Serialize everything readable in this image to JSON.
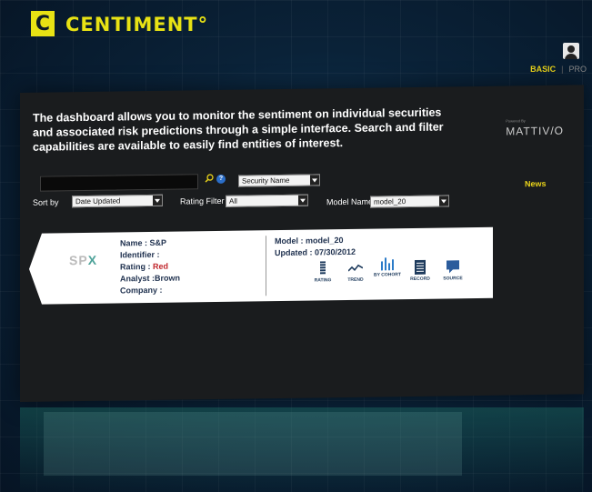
{
  "header": {
    "logo_mark": "C",
    "logo_text": "CENTIMENT°"
  },
  "mode": {
    "basic_label": "BASIC",
    "pro_label": "PRO"
  },
  "intro_text": "The dashboard allows you to monitor the sentiment on individual securities and associated risk predictions through a simple interface. Search and filter capabilities are available to easily find entities of interest.",
  "powered_by": {
    "label": "Powered By",
    "brand": "MATTIV/O"
  },
  "filters": {
    "search_value": "",
    "security_select": "Security Name",
    "sort_label": "Sort by",
    "sort_value": "Date Updated",
    "rating_filter_label": "Rating Filter",
    "rating_filter_value": "All",
    "model_name_label": "Model Name",
    "model_name_value": "model_20"
  },
  "news_label": "News",
  "card": {
    "logo_prefix": "SP",
    "logo_suffix": "X",
    "name": "Name : S&P",
    "identifier": "Identifier :",
    "rating_label": "Rating : ",
    "rating_value": "Red",
    "analyst": "Analyst :Brown",
    "company": "Company :",
    "model": "Model : model_20",
    "updated": "Updated : 07/30/2012",
    "actions": [
      "RATING",
      "TREND",
      "BY COHORT",
      "RECORD",
      "SOURCE"
    ]
  },
  "colors": {
    "accent_yellow": "#e8e214",
    "rating_red": "#c1272d",
    "help_blue": "#2b6ec8"
  }
}
